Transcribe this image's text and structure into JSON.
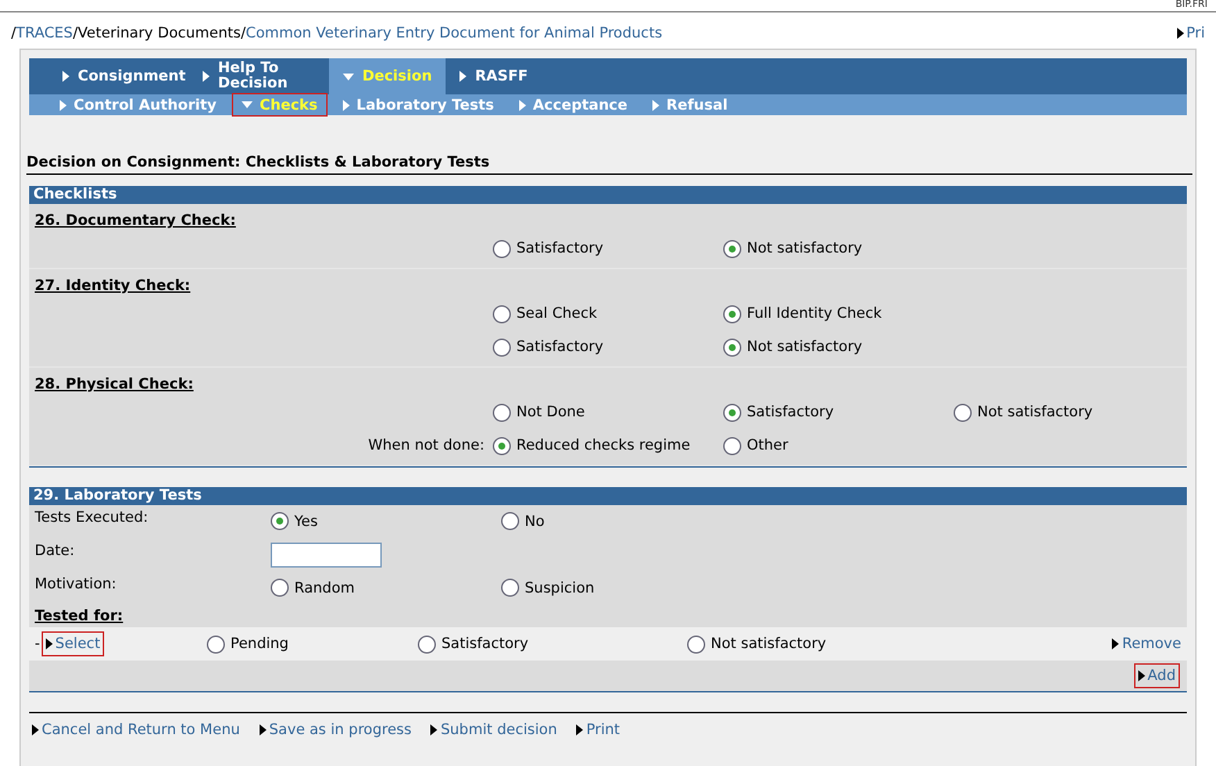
{
  "corner_label": "BIP.FRI",
  "breadcrumb": [
    {
      "text": "/",
      "link": false
    },
    {
      "text": "TRACES",
      "link": true
    },
    {
      "text": "/Veterinary Documents/",
      "link": false
    },
    {
      "text": "Common Veterinary Entry Document for Animal Products",
      "link": true
    }
  ],
  "print_link": "Pri",
  "main_tabs": [
    {
      "label": "Consignment",
      "selected": false
    },
    {
      "label": "Help To Decision",
      "selected": false
    },
    {
      "label": "Decision",
      "selected": true
    },
    {
      "label": "RASFF",
      "selected": false
    }
  ],
  "sub_tabs": [
    {
      "label": "Control Authority",
      "selected": false,
      "highlighted": false
    },
    {
      "label": "Checks",
      "selected": true,
      "highlighted": true
    },
    {
      "label": "Laboratory Tests",
      "selected": false,
      "highlighted": false
    },
    {
      "label": "Acceptance",
      "selected": false,
      "highlighted": false
    },
    {
      "label": "Refusal",
      "selected": false,
      "highlighted": false
    }
  ],
  "page_title": "Decision on Consignment: Checklists & Laboratory Tests",
  "checklists": {
    "title": "Checklists",
    "groups": [
      {
        "heading": "26. Documentary Check:",
        "rows": [
          {
            "options": [
              {
                "label": "Satisfactory",
                "selected": false
              },
              {
                "label": "Not satisfactory",
                "selected": true
              }
            ]
          }
        ]
      },
      {
        "heading": "27. Identity Check:",
        "rows": [
          {
            "options": [
              {
                "label": "Seal Check",
                "selected": false
              },
              {
                "label": "Full Identity Check",
                "selected": true
              }
            ]
          },
          {
            "options": [
              {
                "label": "Satisfactory",
                "selected": false
              },
              {
                "label": "Not satisfactory",
                "selected": true
              }
            ]
          }
        ]
      },
      {
        "heading": "28. Physical Check:",
        "rows": [
          {
            "options": [
              {
                "label": "Not Done",
                "selected": false
              },
              {
                "label": "Satisfactory",
                "selected": true
              },
              {
                "label": "Not satisfactory",
                "selected": false
              }
            ]
          },
          {
            "label": "When not done:",
            "options": [
              {
                "label": "Reduced checks regime",
                "selected": true
              },
              {
                "label": "Other",
                "selected": false
              }
            ]
          }
        ]
      }
    ]
  },
  "laboratory_tests": {
    "title": "29. Laboratory Tests",
    "rows": [
      {
        "kind": "radio",
        "label": "Tests Executed:",
        "options": [
          {
            "label": "Yes",
            "selected": true
          },
          {
            "label": "No",
            "selected": false
          }
        ]
      },
      {
        "kind": "date",
        "label": "Date:"
      },
      {
        "kind": "radio",
        "label": "Motivation:",
        "options": [
          {
            "label": "Random",
            "selected": false
          },
          {
            "label": "Suspicion",
            "selected": false
          }
        ]
      }
    ],
    "tested_for": {
      "heading": "Tested for:",
      "prefix": "-",
      "select_link": "Select",
      "select_highlighted": true,
      "options": [
        {
          "label": "Pending",
          "selected": false
        },
        {
          "label": "Satisfactory",
          "selected": false
        },
        {
          "label": "Not satisfactory",
          "selected": false
        }
      ],
      "remove_link": "Remove",
      "add_link": "Add",
      "add_highlighted": true
    }
  },
  "footer_links": [
    "Cancel and Return to Menu",
    "Save as in progress",
    "Submit decision",
    "Print"
  ]
}
